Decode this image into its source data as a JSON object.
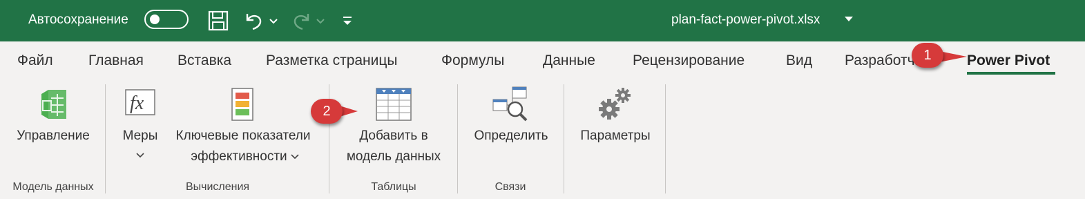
{
  "titlebar": {
    "autosave_label": "Автосохранение",
    "filename": "plan-fact-power-pivot.xlsx"
  },
  "tabs": [
    {
      "label": "Файл"
    },
    {
      "label": "Главная"
    },
    {
      "label": "Вставка"
    },
    {
      "label": "Разметка страницы"
    },
    {
      "label": "Формулы"
    },
    {
      "label": "Данные"
    },
    {
      "label": "Рецензирование"
    },
    {
      "label": "Вид"
    },
    {
      "label": "Разработчик"
    },
    {
      "label": "Power Pivot",
      "active": true
    }
  ],
  "ribbon": {
    "buttons": {
      "manage": "Управление",
      "measures": "Меры",
      "kpi_line1": "Ключевые показатели",
      "kpi_line2": "эффективности",
      "add_line1": "Добавить в",
      "add_line2": "модель данных",
      "detect": "Определить",
      "settings": "Параметры"
    },
    "groups": {
      "data_model": "Модель данных",
      "calculations": "Вычисления",
      "tables": "Таблицы",
      "relationships": "Связи"
    }
  },
  "annotations": {
    "badge1": "1",
    "badge2": "2"
  },
  "colors": {
    "titlebar": "#217346",
    "accent": "#217346",
    "badge": "#d63a3a"
  }
}
